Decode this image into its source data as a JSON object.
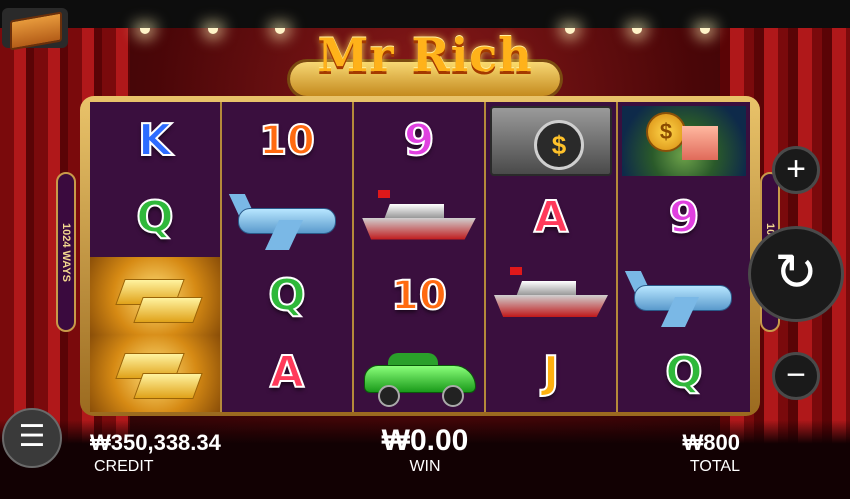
{
  "game": {
    "title": "Mr Rich",
    "ways_label": "1024 WAYS"
  },
  "reels": [
    [
      "K",
      "10",
      "9",
      "vault",
      "coin-island"
    ],
    [
      "Q",
      "plane",
      "yacht",
      "A",
      "9"
    ],
    [
      "gold-bars",
      "Q",
      "10",
      "yacht",
      "plane"
    ],
    [
      "gold-bars",
      "A",
      "car",
      "J",
      "Q"
    ]
  ],
  "controls": {
    "plus_icon": "+",
    "spin_icon": "↻",
    "minus_icon": "−",
    "menu_icon": "☰"
  },
  "balance": {
    "credit_value": "₩350,338.34",
    "credit_label": "CREDIT",
    "win_value": "₩0.00",
    "win_label": "WIN",
    "total_value": "₩800",
    "total_label": "TOTAL"
  }
}
